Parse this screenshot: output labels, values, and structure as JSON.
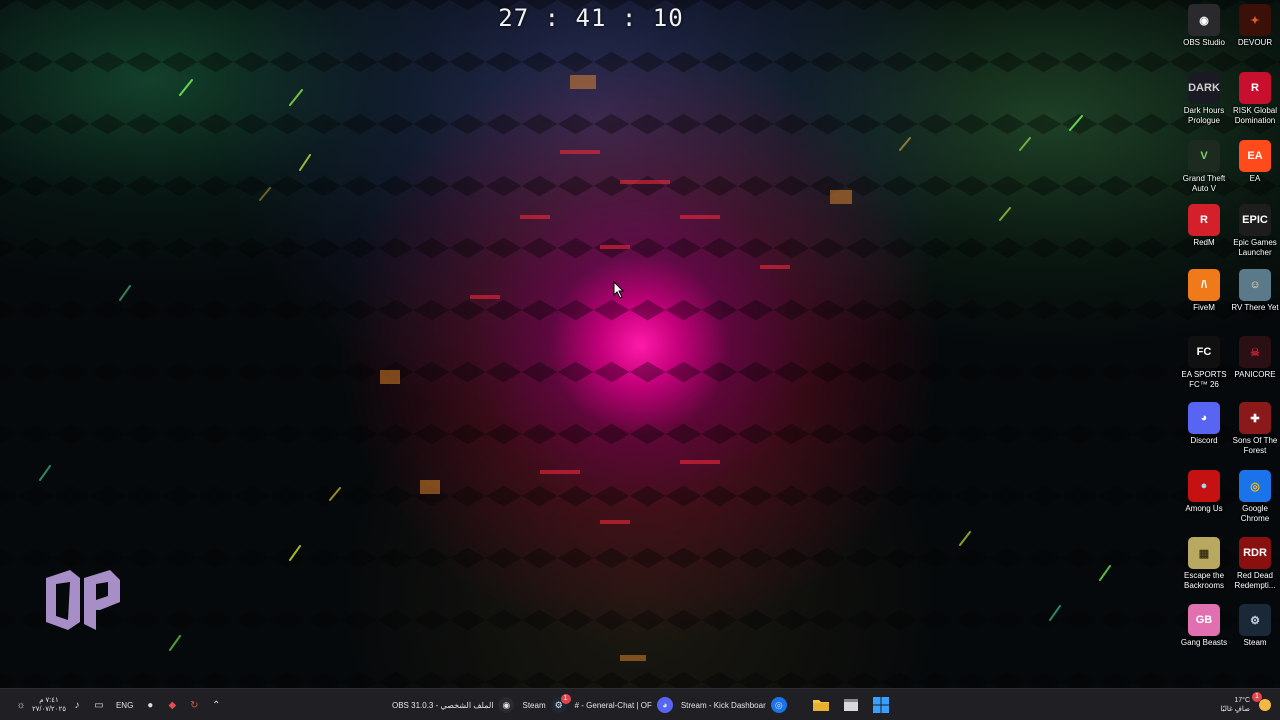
{
  "overlay": {
    "timer": "27 : 41 : 10"
  },
  "desktop_icons": [
    {
      "label": "OBS Studio",
      "icon": "obs-icon",
      "glyph": "◉",
      "bg": "#2a2a2e",
      "fg": "#ffffff"
    },
    {
      "label": "DEVOUR",
      "icon": "devour-icon",
      "glyph": "✦",
      "bg": "#3a1008",
      "fg": "#e05a2a"
    },
    {
      "label": "Dark Hours Prologue",
      "icon": "dark-hours-icon",
      "glyph": "DARK",
      "bg": "#1a1a22",
      "fg": "#cfcfcf"
    },
    {
      "label": "RISK Global Domination",
      "icon": "risk-icon",
      "glyph": "R",
      "bg": "#c8102e",
      "fg": "#ffffff"
    },
    {
      "label": "Grand Theft Auto V",
      "icon": "gta-icon",
      "glyph": "V",
      "bg": "#1c2a20",
      "fg": "#7bd36b"
    },
    {
      "label": "EA",
      "icon": "ea-icon",
      "glyph": "EA",
      "bg": "#ff4a1c",
      "fg": "#ffffff"
    },
    {
      "label": "RedM",
      "icon": "redm-icon",
      "glyph": "R",
      "bg": "#d3202a",
      "fg": "#ffffff"
    },
    {
      "label": "Epic Games Launcher",
      "icon": "epic-games-icon",
      "glyph": "EPIC",
      "bg": "#1d1d1d",
      "fg": "#ffffff"
    },
    {
      "label": "FiveM",
      "icon": "fivem-icon",
      "glyph": "/\\",
      "bg": "#f07a1a",
      "fg": "#ffffff"
    },
    {
      "label": "RV There Yet",
      "icon": "rv-there-yet-icon",
      "glyph": "☺",
      "bg": "#5a7a8a",
      "fg": "#ffe0c0"
    },
    {
      "label": "EA SPORTS FC™ 26",
      "icon": "ea-sports-fc-icon",
      "glyph": "FC",
      "bg": "#101010",
      "fg": "#ffffff"
    },
    {
      "label": "PANICORE",
      "icon": "panicore-icon",
      "glyph": "☠",
      "bg": "#2a1014",
      "fg": "#b02030"
    },
    {
      "label": "Discord",
      "icon": "discord-icon",
      "glyph": "◕",
      "bg": "#5865f2",
      "fg": "#ffffff"
    },
    {
      "label": "Sons Of The Forest",
      "icon": "sons-of-the-forest-icon",
      "glyph": "✚",
      "bg": "#8a1a1a",
      "fg": "#ffffff"
    },
    {
      "label": "Among Us",
      "icon": "among-us-icon",
      "glyph": "●",
      "bg": "#c51111",
      "fg": "#9fd8f0"
    },
    {
      "label": "Google Chrome",
      "icon": "chrome-icon",
      "glyph": "◎",
      "bg": "#1a73e8",
      "fg": "#fbbc04"
    },
    {
      "label": "Escape the Backrooms",
      "icon": "escape-backrooms-icon",
      "glyph": "▦",
      "bg": "#b8a860",
      "fg": "#3a3010"
    },
    {
      "label": "Red Dead Redempti...",
      "icon": "red-dead-icon",
      "glyph": "RDR",
      "bg": "#8a1010",
      "fg": "#ffffff"
    },
    {
      "label": "Gang Beasts",
      "icon": "gang-beasts-icon",
      "glyph": "GB",
      "bg": "#e070b0",
      "fg": "#ffffff"
    },
    {
      "label": "Steam",
      "icon": "steam-icon",
      "glyph": "⚙",
      "bg": "#1b2838",
      "fg": "#c7d5e0"
    }
  ],
  "taskbar": {
    "datetime_time": "٧:٤١ م",
    "datetime_date": "٢٧/٠٧/٢٠٢٥",
    "language": "ENG",
    "tasks": [
      {
        "label": "OBS 31.0.3 - الملف الشخصي",
        "icon": "obs-icon",
        "glyph": "◉",
        "bg": "#2a2a2e"
      },
      {
        "label": "Steam",
        "icon": "steam-icon",
        "glyph": "⚙",
        "bg": "#1b2838"
      },
      {
        "label": "# - General-Chat | OF",
        "icon": "discord-icon",
        "glyph": "◕",
        "bg": "#5865f2",
        "badge": "1"
      },
      {
        "label": "Stream - Kick Dashboar",
        "icon": "chrome-icon",
        "glyph": "◎",
        "bg": "#1a73e8"
      }
    ],
    "weather_temp": "17°C",
    "weather_desc": "صافٍ غالبًا",
    "notification_count": "1"
  }
}
